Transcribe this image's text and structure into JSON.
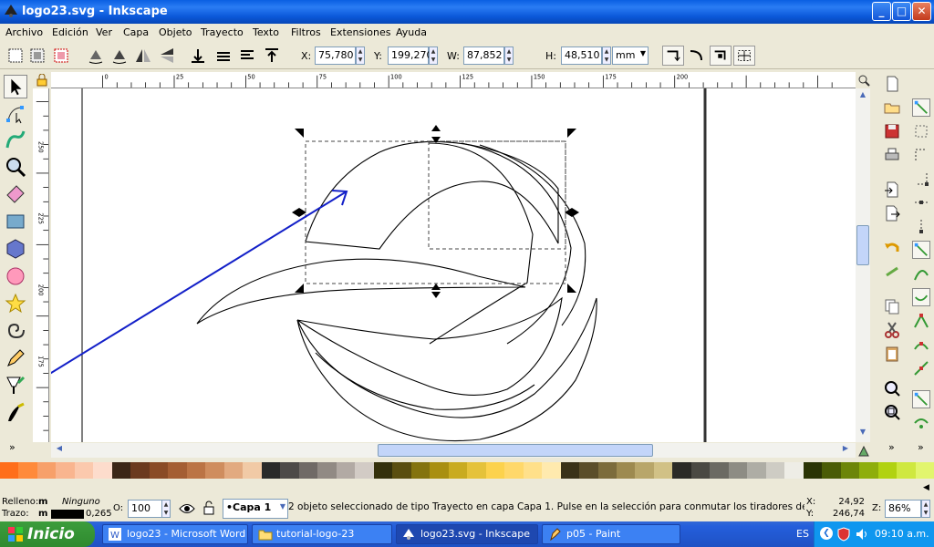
{
  "window": {
    "title": "logo23.svg - Inkscape",
    "minimize": "_",
    "maximize": "□",
    "close": "✕"
  },
  "menu": [
    "Archivo",
    "Edición",
    "Ver",
    "Capa",
    "Objeto",
    "Trayecto",
    "Texto",
    "Filtros",
    "Extensiones",
    "Ayuda"
  ],
  "toolbar": {
    "x_label": "X:",
    "x_value": "75,780",
    "y_label": "Y:",
    "y_value": "199,270",
    "w_label": "W:",
    "w_value": "87,852",
    "h_label": "H:",
    "h_value": "48,510",
    "unit": "mm"
  },
  "ruler": {
    "top_ticks": [
      "0",
      "25",
      "50",
      "75",
      "100",
      "125",
      "150",
      "175",
      "200"
    ],
    "left_ticks": [
      "250",
      "225",
      "200",
      "175"
    ]
  },
  "tools": [
    "selector-icon",
    "node-icon",
    "tweak-icon",
    "zoom-icon",
    "measure-icon",
    "rect-icon",
    "box3d-icon",
    "ellipse-icon",
    "star-icon",
    "spiral-icon",
    "pencil-icon",
    "pen-icon",
    "calligraphy-icon"
  ],
  "palette": [
    "#ff6e1a",
    "#ff8a3a",
    "#f7a06a",
    "#f9b58f",
    "#fbc9ad",
    "#fddccc",
    "#3b2616",
    "#6b3a1f",
    "#8a4b26",
    "#a45e33",
    "#bb7445",
    "#cf8d5e",
    "#e2aa80",
    "#f1caa6",
    "#2a2a2a",
    "#4d4a48",
    "#706a66",
    "#918a84",
    "#b2aaa4",
    "#d2cbc5",
    "#34300c",
    "#5a4e10",
    "#84730f",
    "#a98f11",
    "#c9ab20",
    "#e5c23a",
    "#fcd24d",
    "#ffd86a",
    "#ffe08a",
    "#ffeaae",
    "#3a3218",
    "#5b4e2a",
    "#7c6c3c",
    "#9d8a50",
    "#b8a66a",
    "#d1c186",
    "#2b2b27",
    "#4a4943",
    "#6b6a63",
    "#8d8c84",
    "#aeada5",
    "#ceccc4",
    "#eeede6",
    "#2a3405",
    "#4a5c06",
    "#6c8508",
    "#8eae0b",
    "#b1d211",
    "#cfe840",
    "#e2f56e"
  ],
  "status": {
    "fill_label": "Relleno:",
    "fill_m": "m",
    "fill_value": "Ninguno",
    "stroke_label": "Trazo:",
    "stroke_m": "m",
    "stroke_width": "0,265",
    "opacity_label": "O:",
    "opacity_value": "100",
    "layer": "•Capa 1",
    "message": "2 objeto seleccionado de tipo Trayecto en capa Capa 1. Pulse en la selección para conmutar los tiradores de esca...",
    "coord_x_label": "X:",
    "coord_x": "24,92",
    "coord_y_label": "Y:",
    "coord_y": "246,74",
    "zoom_label": "Z:",
    "zoom_value": "86%"
  },
  "taskbar": {
    "start": "Inicio",
    "tasks": [
      "logo23 - Microsoft Word",
      "tutorial-logo-23",
      "logo23.svg - Inkscape",
      "p05 - Paint"
    ],
    "lang": "ES",
    "clock": "09:10 a.m."
  }
}
